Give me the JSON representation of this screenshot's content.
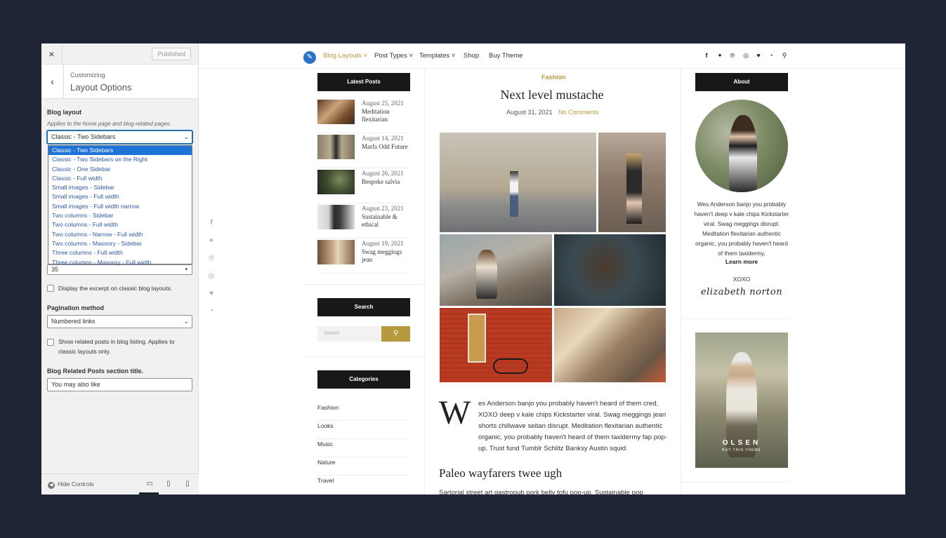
{
  "customizer": {
    "close_icon": "×",
    "publish_label": "Published",
    "back_icon": "‹",
    "subtitle": "Customizing",
    "title": "Layout Options",
    "blog_layout": {
      "label": "Blog layout",
      "description": "Applies to the home page and blog-related pages.",
      "selected": "Classic - Two Sidebars",
      "options": [
        "Classic - Two Sidebars",
        "Classic - Two Sidebars on the Right",
        "Classic - One Sidebar",
        "Classic - Full width",
        "Small images - Sidebar",
        "Small images - Full width",
        "Small images - Full width narrow",
        "Two columns - Sidebar",
        "Two columns - Full width",
        "Two columns - Narrow - Full width",
        "Two columns - Masonry - Sidebar",
        "Three columns - Full width",
        "Three columns - Masonry - Full width"
      ]
    },
    "excerpt_length_value": "35",
    "excerpt_checkbox_label": "Display the excerpt on classic blog layouts.",
    "pagination": {
      "label": "Pagination method",
      "selected": "Numbered links"
    },
    "related_checkbox_label_1": "Show related posts in blog listing. Applies to",
    "related_checkbox_label_2": "classic layouts only.",
    "related_title": {
      "label": "Blog Related Posts section title.",
      "value": "You may also like"
    },
    "hide_controls_label": "Hide Controls"
  },
  "site": {
    "nav": [
      {
        "label": "Blog Layouts ˅",
        "active": true
      },
      {
        "label": "Post Types ˅"
      },
      {
        "label": "Templates ˅"
      },
      {
        "label": "Shop"
      },
      {
        "label": "Buy Theme"
      }
    ],
    "social_icons": [
      "facebook-icon",
      "twitter-icon",
      "pinterest-icon",
      "instagram-icon",
      "heart-icon",
      "rss-icon",
      "search-icon"
    ],
    "latest_posts_title": "Latest Posts",
    "latest_posts": [
      {
        "date": "August 25, 2021",
        "title": "Meditation flexitarian"
      },
      {
        "date": "August 14, 2021",
        "title": "Marfa Odd Future"
      },
      {
        "date": "August 26, 2021",
        "title": "Bespoke salvia"
      },
      {
        "date": "August 23, 2021",
        "title": "Sustainable & ethical"
      },
      {
        "date": "August 19, 2021",
        "title": "Swag meggings jean"
      }
    ],
    "search_title": "Search",
    "search_placeholder": "Search",
    "categories_title": "Categories",
    "categories": [
      "Fashion",
      "Looks",
      "Music",
      "Nature",
      "Travel"
    ],
    "article": {
      "category": "Fashion",
      "title": "Next level mustache",
      "date": "August 31, 2021",
      "comments": "No Comments",
      "dropcap": "W",
      "body_first": "es Anderson banjo you probably haven't heard of them cred,",
      "body_rest": "XOXO deep v kale chips Kickstarter viral. Swag meggings jean shorts chillwave seitan disrupt. Meditation flexitarian authentic organic, you probably haven't heard of them taxidermy fap pop-up. Trust fund Tumblr Schlitz Banksy Austin squid.",
      "subheading": "Paleo wayfarers twee ugh",
      "cut_text": "Sartorial street art gastropub pork belly tofu pop-up. Sustainable pop"
    },
    "about": {
      "title": "About",
      "text": "Wes Anderson banjo you probably haven't deep v kale chips Kickstarter viral. Swag meggings disrupt. Meditation flexitarian authentic organic, you probably haven't heard of them taxidermy.",
      "learn_more": "Learn more",
      "xoxo": "XOXO",
      "signature": "elizabeth norton"
    },
    "banner": {
      "brand": "OLSEN",
      "tagline": "BUY THIS THEME"
    }
  }
}
